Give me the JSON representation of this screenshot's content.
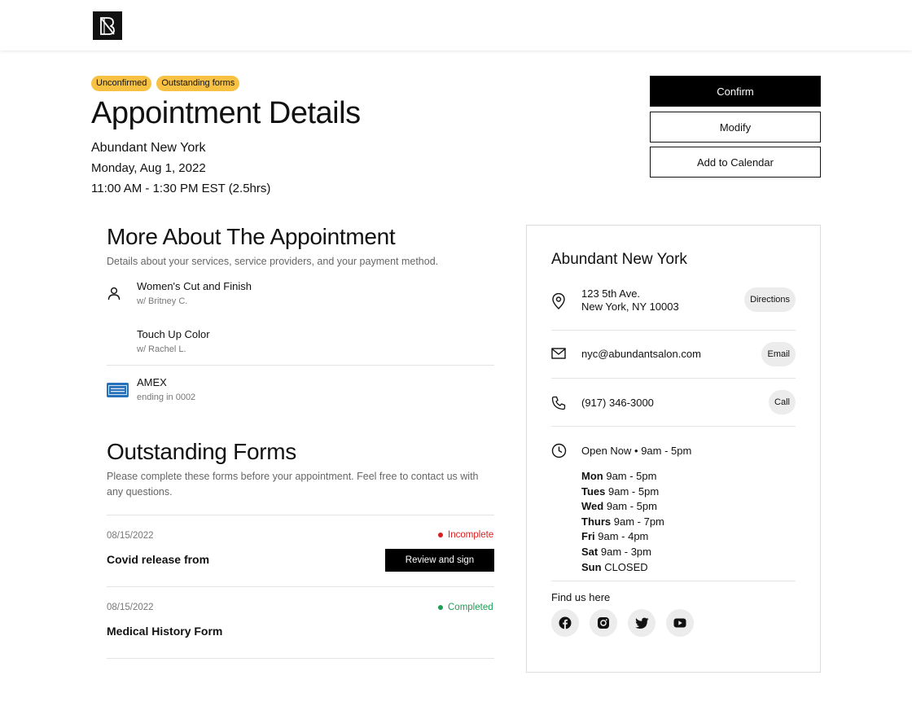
{
  "header": {
    "logo_alt": "Abundant logo"
  },
  "status_badges": [
    "Unconfirmed",
    "Outstanding forms"
  ],
  "appointment": {
    "title": "Appointment Details",
    "venue": "Abundant New York",
    "date": "Monday, Aug 1, 2022",
    "time": "11:00 AM - 1:30 PM EST (2.5hrs)"
  },
  "actions": {
    "confirm": "Confirm",
    "modify": "Modify",
    "add_to_calendar": "Add to Calendar"
  },
  "more_about": {
    "title": "More About The Appointment",
    "description": "Details about your services, service providers, and your payment method.",
    "services": [
      {
        "name": "Women's Cut and Finish",
        "provider": "w/ Britney C."
      },
      {
        "name": "Touch Up Color",
        "provider": "w/ Rachel L."
      }
    ],
    "payment": {
      "card": "AMEX",
      "ending": "ending in 0002",
      "icon": "amex-card-icon"
    }
  },
  "outstanding_forms": {
    "title": "Outstanding Forms",
    "description": "Please complete these forms before your appointment. Feel free to contact us with any questions.",
    "forms": [
      {
        "date": "08/15/2022",
        "status": "Incomplete",
        "status_color": "#d61f1f",
        "name": "Covid release from",
        "action": "Review and sign"
      },
      {
        "date": "08/15/2022",
        "status": "Completed",
        "status_color": "#1f9d55",
        "name": "Medical History Form"
      }
    ]
  },
  "location_card": {
    "title": "Abundant New York",
    "address_line1": "123 5th Ave.",
    "address_line2": "New York, NY 10003",
    "directions": "Directions",
    "email": "nyc@abundantsalon.com",
    "email_btn": "Email",
    "phone": "(917) 346-3000",
    "call_btn": "Call",
    "open_now": "Open Now • 9am - 5pm",
    "hours": [
      {
        "day": "Mon",
        "time": "9am - 5pm"
      },
      {
        "day": "Tues",
        "time": "9am - 5pm"
      },
      {
        "day": "Wed",
        "time": "9am - 5pm"
      },
      {
        "day": "Thurs",
        "time": "9am - 7pm"
      },
      {
        "day": "Fri",
        "time": "9am - 4pm"
      },
      {
        "day": "Sat",
        "time": "9am - 3pm"
      },
      {
        "day": "Sun",
        "time": "CLOSED"
      }
    ],
    "find_us": "Find us here",
    "socials": [
      "facebook-icon",
      "instagram-icon",
      "twitter-icon",
      "youtube-icon"
    ]
  }
}
